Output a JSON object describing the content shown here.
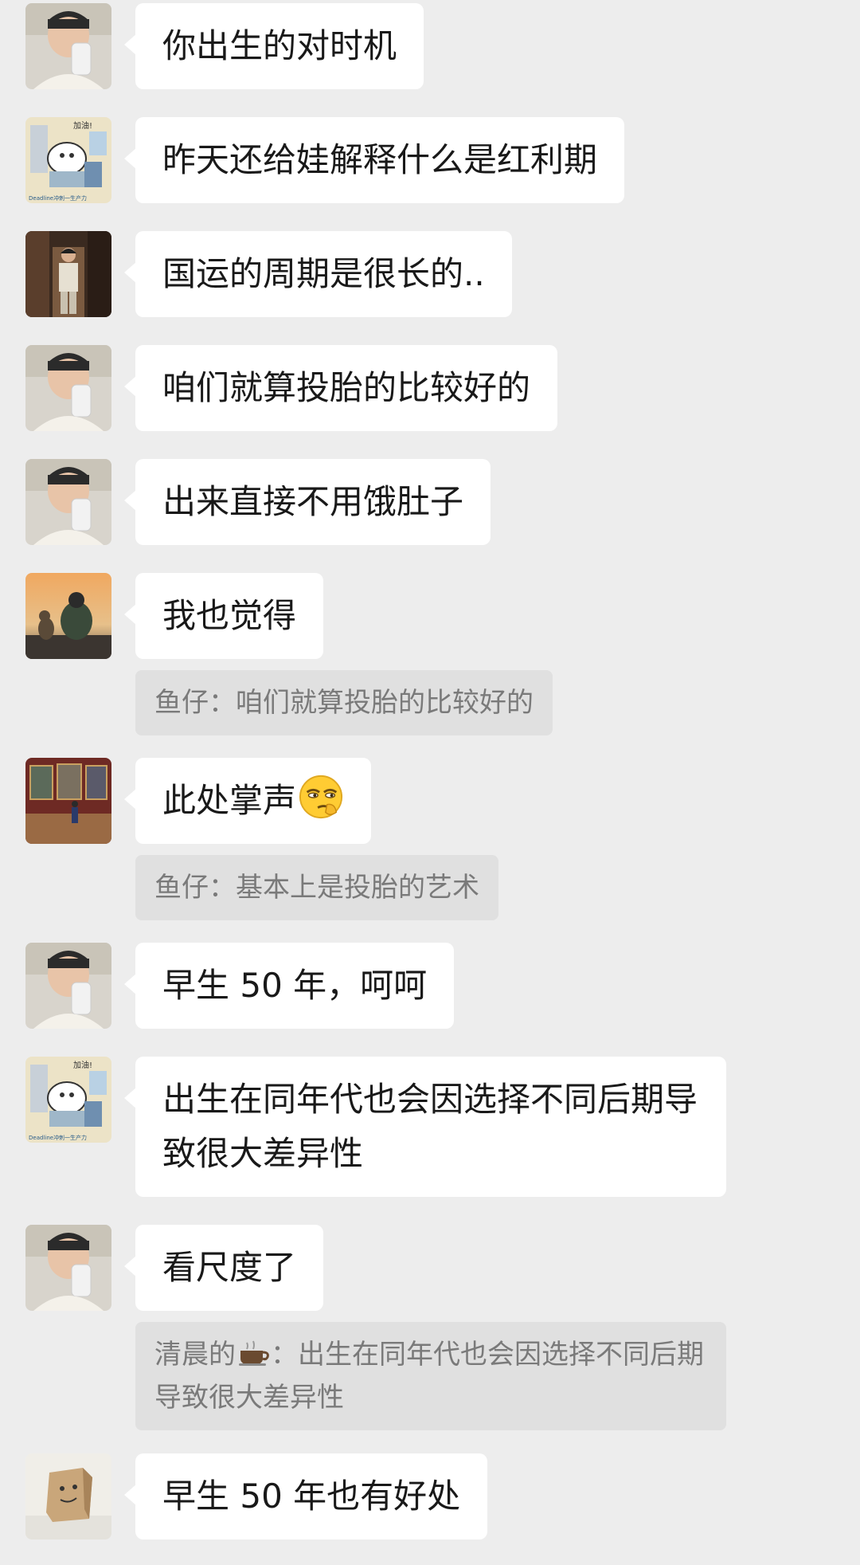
{
  "messages": [
    {
      "avatar": "selfie-avatar",
      "text": "你出生的对时机"
    },
    {
      "avatar": "cartoon-avatar",
      "text": "昨天还给娃解释什么是红利期"
    },
    {
      "avatar": "man-standing-avatar",
      "text": "国运的周期是很长的.."
    },
    {
      "avatar": "selfie-avatar",
      "text": "咱们就算投胎的比较好的"
    },
    {
      "avatar": "selfie-avatar",
      "text": "出来直接不用饿肚子"
    },
    {
      "avatar": "sunset-avatar",
      "text": "我也觉得",
      "quote": "鱼仔：咱们就算投胎的比较好的"
    },
    {
      "avatar": "gallery-avatar",
      "text": "此处掌声",
      "emoji": "smirk-face-icon",
      "quote": "鱼仔：基本上是投胎的艺术"
    },
    {
      "avatar": "selfie-avatar",
      "text": "早生 50 年，呵呵"
    },
    {
      "avatar": "cartoon-avatar",
      "text": "出生在同年代也会因选择不同后期导致很大差异性"
    },
    {
      "avatar": "selfie-avatar",
      "text": "看尺度了",
      "quote_prefix": "清晨的",
      "quote_icon": "coffee-icon",
      "quote_rest": "：出生在同年代也会因选择不同后期导致很大差异性"
    },
    {
      "avatar": "box-avatar",
      "text": "早生 50 年也有好处"
    }
  ],
  "cartoon_avatar_text": {
    "top": "加油!",
    "bottom": "Deadline冲刺一生产力"
  }
}
